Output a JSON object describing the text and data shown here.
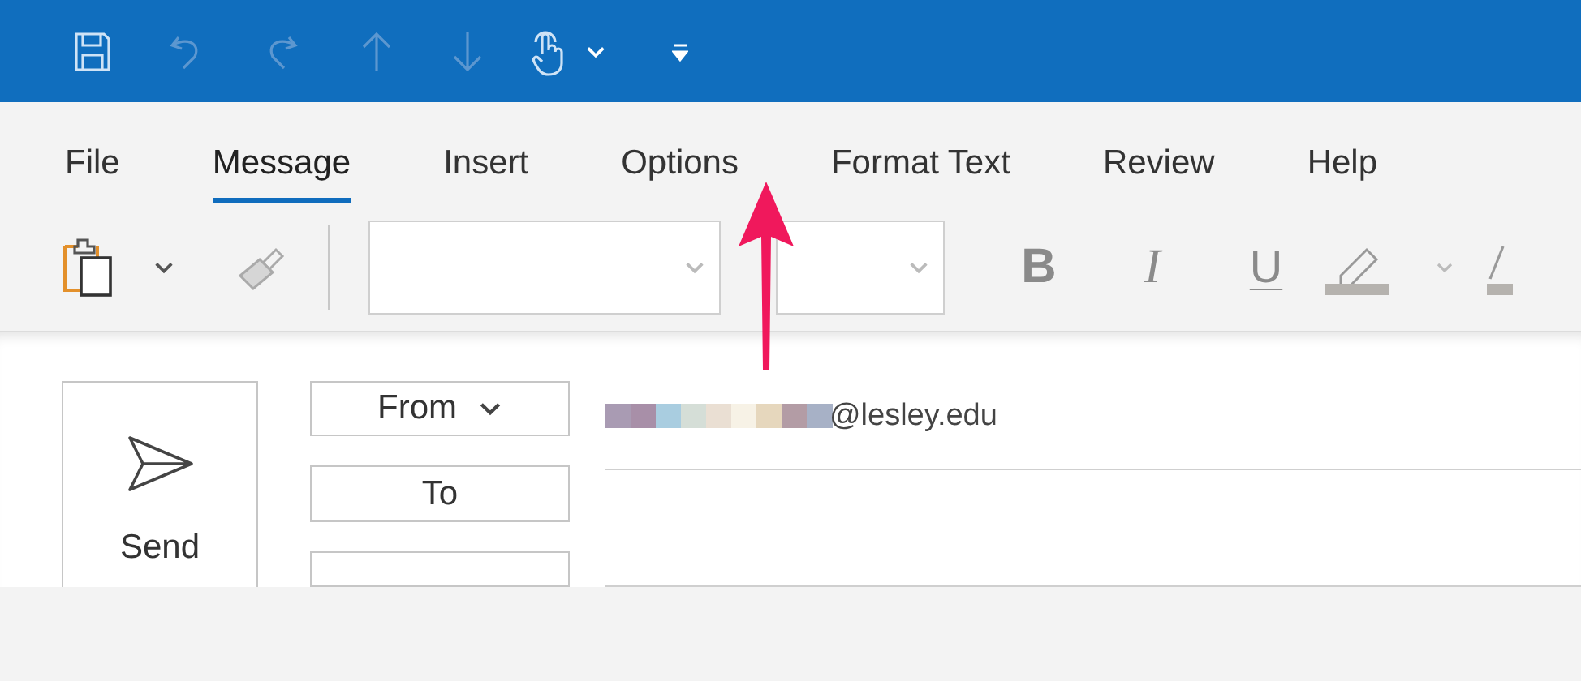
{
  "tabs": [
    {
      "label": "File",
      "selected": false
    },
    {
      "label": "Message",
      "selected": true
    },
    {
      "label": "Insert",
      "selected": false
    },
    {
      "label": "Options",
      "selected": false
    },
    {
      "label": "Format Text",
      "selected": false
    },
    {
      "label": "Review",
      "selected": false
    },
    {
      "label": "Help",
      "selected": false
    }
  ],
  "format_buttons": [
    {
      "kind": "bold",
      "label": "B"
    },
    {
      "kind": "italic",
      "label": "I"
    },
    {
      "kind": "underline",
      "label": "U"
    }
  ],
  "compose": {
    "send_button": "Send",
    "from_button": "From",
    "to_button": "To",
    "from_address": "@lesley.edu"
  }
}
